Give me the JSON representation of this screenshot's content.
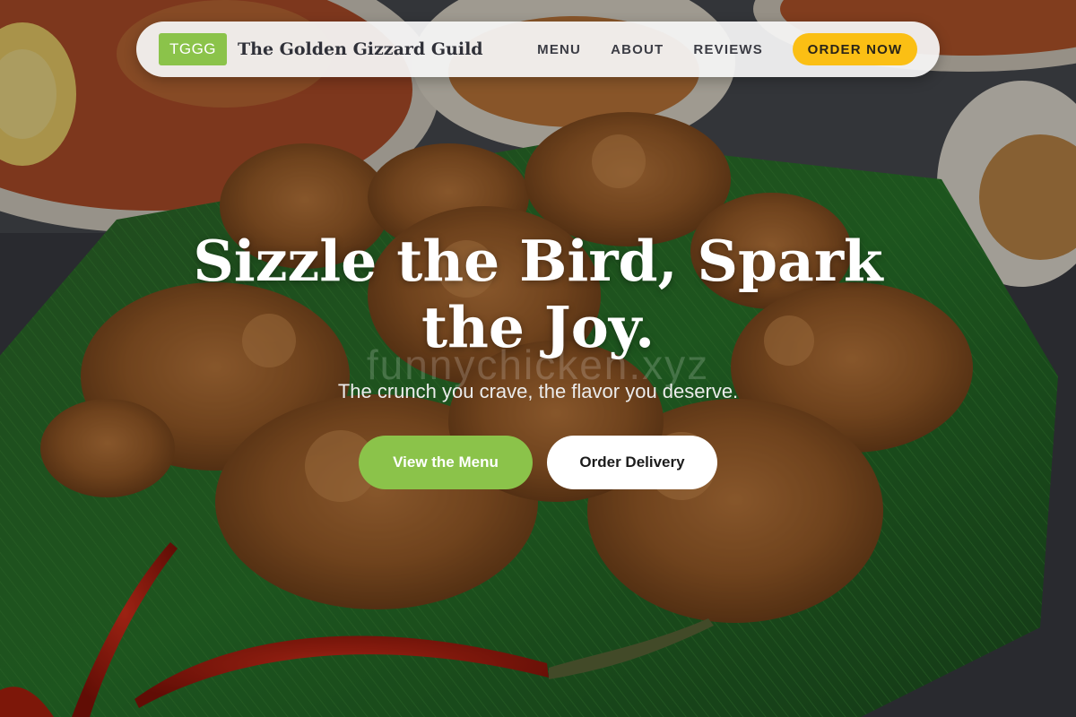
{
  "nav": {
    "logo_badge": "TGGG",
    "brand_name": "The Golden Gizzard Guild",
    "links": [
      {
        "label": "MENU"
      },
      {
        "label": "ABOUT"
      },
      {
        "label": "REVIEWS"
      }
    ],
    "cta_label": "ORDER NOW"
  },
  "hero": {
    "headline": "Sizzle the Bird, Spark the Joy.",
    "watermark": "funnychicken.xyz",
    "subtitle": "The crunch you crave, the flavor you deserve.",
    "primary_button": "View the Menu",
    "secondary_button": "Order Delivery",
    "background_image": "fried-chicken-on-banana-leaf-photo"
  },
  "colors": {
    "accent_green": "#8bc34a",
    "accent_yellow": "#fbbf14",
    "nav_background": "#f6f6f6",
    "headline_text": "#ffffff"
  }
}
